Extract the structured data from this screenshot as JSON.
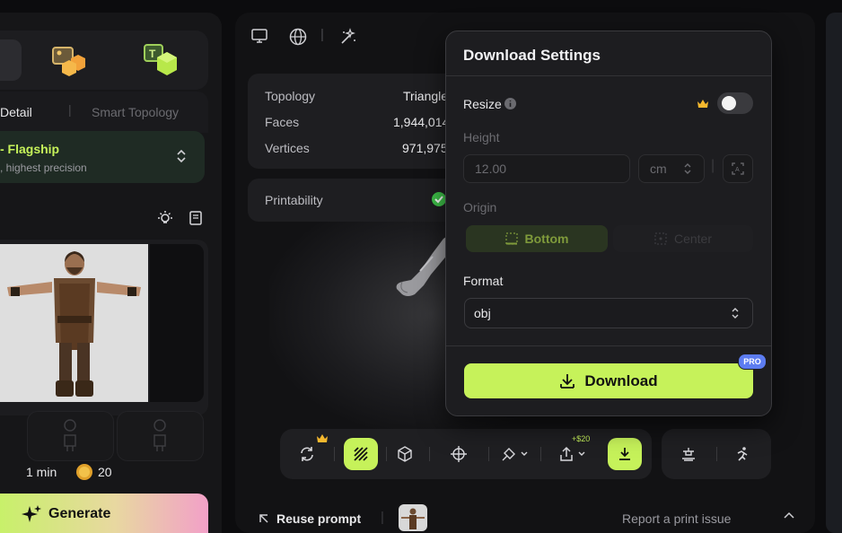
{
  "left": {
    "mode_tabs": [
      "Detail",
      "Smart Topology"
    ],
    "quality_title": "- Flagship",
    "quality_sub": ", highest precision",
    "time": "1 min",
    "credits": "20",
    "generate_label": "Generate"
  },
  "stats": {
    "rows": [
      {
        "label": "Topology",
        "value": "Triangle"
      },
      {
        "label": "Faces",
        "value": "1,944,014"
      },
      {
        "label": "Vertices",
        "value": "971,975"
      }
    ],
    "printability": "Printability"
  },
  "toolbar": {
    "export_price": "+$20"
  },
  "bottom_bar": {
    "reuse_prompt": "Reuse prompt",
    "report": "Report a print issue"
  },
  "modal": {
    "title": "Download Settings",
    "resize_label": "Resize",
    "height_label": "Height",
    "height_value": "12.00",
    "unit": "cm",
    "origin_label": "Origin",
    "origin_options": [
      "Bottom",
      "Center"
    ],
    "format_label": "Format",
    "format_value": "obj",
    "download_label": "Download",
    "pro_badge": "PRO"
  },
  "colors": {
    "accent": "#c6f25a",
    "pro": "#5c7cf0",
    "crown": "#f5b82e"
  }
}
